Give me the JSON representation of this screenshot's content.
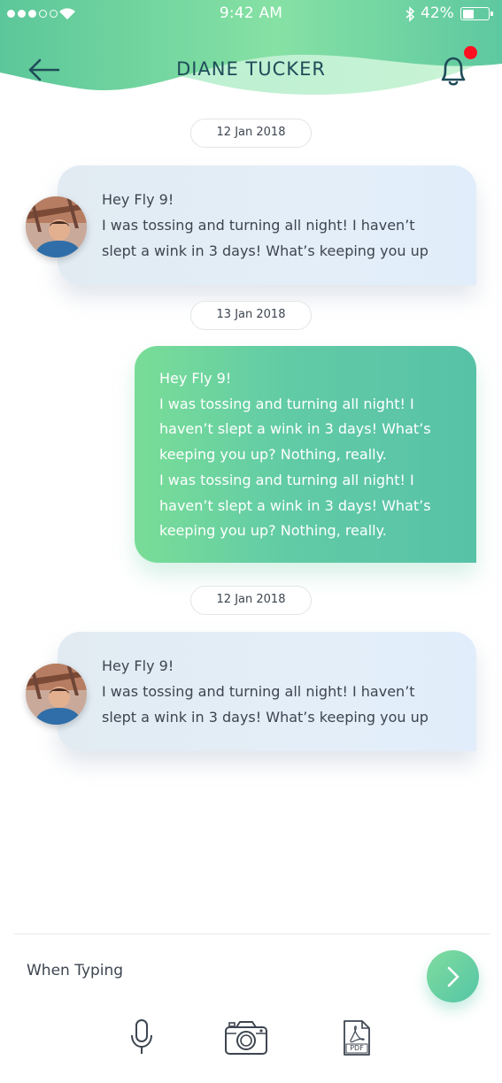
{
  "status": {
    "time": "9:42 AM",
    "battery": "42%"
  },
  "header": {
    "title": "DIANE TUCKER"
  },
  "messages": [
    {
      "date": "12 Jan 2018",
      "direction": "incoming",
      "lines": [
        "Hey Fly 9!",
        "I was tossing and turning all night! I haven’t",
        "slept a wink in 3 days! What’s keeping you up"
      ]
    },
    {
      "date": "13 Jan 2018",
      "direction": "outgoing",
      "lines": [
        "Hey Fly 9!",
        "I was tossing and turning all night! I",
        "haven’t slept a wink in 3 days! What’s",
        "keeping you up? Nothing, really.",
        "I was tossing and turning all night! I",
        "haven’t slept a wink in 3 days! What’s",
        "keeping you up? Nothing, really."
      ]
    },
    {
      "date": "12 Jan 2018",
      "direction": "incoming",
      "lines": [
        "Hey Fly 9!",
        "I was tossing and turning all night! I haven’t",
        "slept a wink in 3 days! What’s keeping you up"
      ]
    }
  ],
  "composer": {
    "placeholder": "When Typing",
    "pdf_label": "PDF"
  },
  "icons": [
    "back-arrow-icon",
    "bell-icon",
    "microphone-icon",
    "camera-icon",
    "pdf-file-icon",
    "chevron-right-icon"
  ],
  "colors": {
    "accent": "#5fcaa6",
    "title": "#1f4c59",
    "badge": "#ff1020"
  }
}
